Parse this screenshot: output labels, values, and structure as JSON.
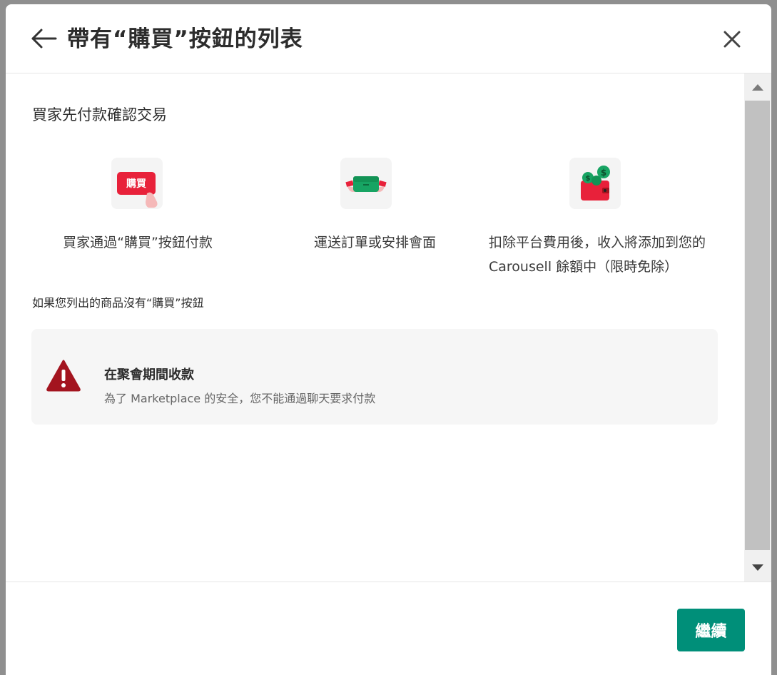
{
  "header": {
    "title": "帶有“購買”按鈕的列表",
    "back_icon": "arrow-left-icon",
    "close_icon": "close-icon"
  },
  "section_title": "買家先付款確認交易",
  "steps": [
    {
      "icon": "buy-button-icon",
      "icon_label": "購買",
      "text": "買家通過“購買”按鈕付款"
    },
    {
      "icon": "package-handoff-icon",
      "text": "運送訂單或安排會面"
    },
    {
      "icon": "wallet-coins-icon",
      "text": "扣除平台費用後，收入將添加到您的 Carousell 餘額中（限時免除）"
    }
  ],
  "note_heading": "如果您列出的商品沒有“購買”按鈕",
  "warning": {
    "icon": "warning-triangle-icon",
    "title": "在聚會期間收款",
    "description": "為了 Marketplace 的安全，您不能通過聊天要求付款"
  },
  "footer": {
    "continue_label": "繼續"
  },
  "colors": {
    "accent": "#008f79",
    "red": "#e8213a",
    "warning": "#a3141f"
  }
}
